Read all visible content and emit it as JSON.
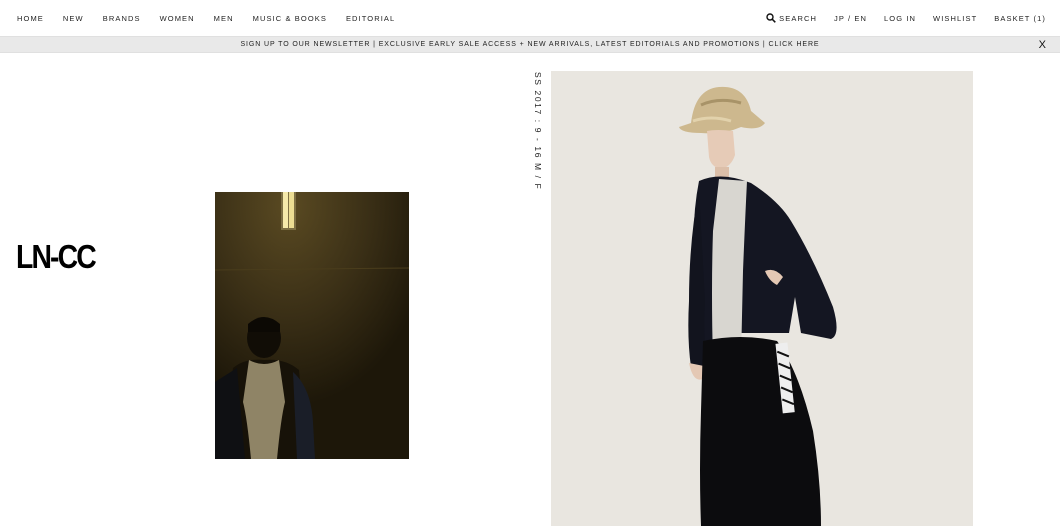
{
  "nav": {
    "left": [
      "HOME",
      "NEW",
      "BRANDS",
      "WOMEN",
      "MEN",
      "MUSIC & BOOKS",
      "EDITORIAL"
    ],
    "search_label": "SEARCH",
    "language": "JP / EN",
    "login": "LOG IN",
    "wishlist": "WISHLIST",
    "basket": "BASKET (1)"
  },
  "banner": {
    "text": "SIGN UP TO OUR NEWSLETTER | EXCLUSIVE EARLY SALE ACCESS + NEW ARRIVALS, LATEST EDITORIALS AND PROMOTIONS | CLICK HERE",
    "close": "X"
  },
  "logo": "LN-CC",
  "campaign": {
    "label": "SS 2017 : 9 - 16 M / F"
  },
  "colors": {
    "banner_bg": "#e9e9e9",
    "dark_photo_bg": "#2a2010",
    "light_photo_bg": "#e9e6e0"
  },
  "icons": {
    "search": "search-icon",
    "close": "close-icon"
  }
}
